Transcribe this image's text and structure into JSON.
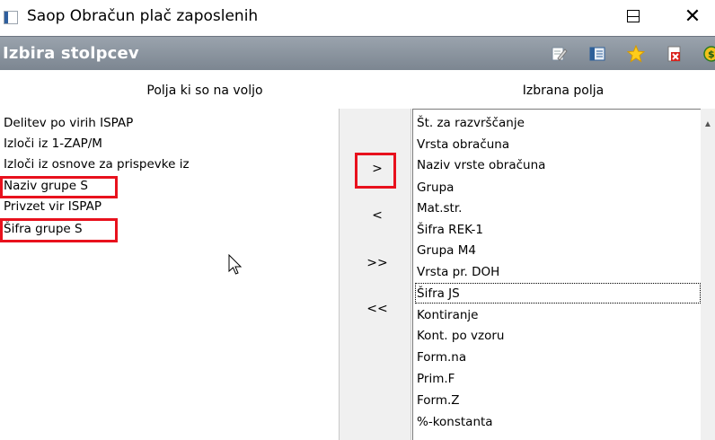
{
  "window": {
    "title": "Saop Obračun plač zaposlenih"
  },
  "toolbar": {
    "title": "Izbira stolpcev",
    "icons": [
      "edit-icon",
      "columns-icon",
      "star-icon",
      "delete-document-icon",
      "dollar-icon"
    ]
  },
  "headers": {
    "available": "Polja ki so na voljo",
    "selected": "Izbrana polja"
  },
  "available_fields": [
    "Delitev po virih ISPAP",
    "Izloči iz 1-ZAP/M",
    "Izloči iz osnove za prispevke iz",
    "Naziv grupe S",
    "Privzet vir ISPAP",
    "Šifra grupe S"
  ],
  "move_buttons": {
    "add": ">",
    "remove": "<",
    "add_all": ">>",
    "remove_all": "<<"
  },
  "selected_fields": [
    "Št.  za razvrščanje",
    "Vrsta obračuna",
    "Naziv vrste obračuna",
    "Grupa",
    "Mat.str.",
    "Šifra REK-1",
    "Grupa M4",
    "Vrsta pr. DOH",
    "Šifra JS",
    "Kontiranje",
    "Kont. po vzoru",
    "Form.na",
    "Prim.F",
    "Form.Z",
    "%-konstanta"
  ],
  "colors": {
    "toolbar": "#8d96a0",
    "highlight": "#e8111d"
  }
}
